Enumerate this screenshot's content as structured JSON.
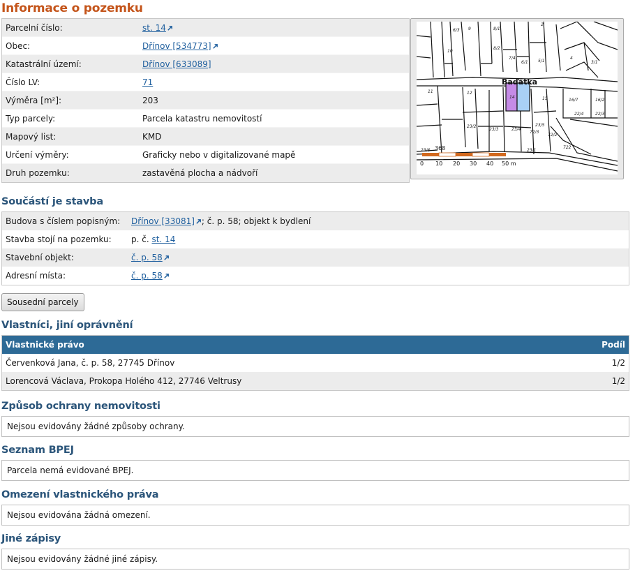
{
  "page_title": "Informace o pozemku",
  "parcel": {
    "rows": [
      {
        "label": "Parcelní číslo:",
        "value": "st. 14",
        "link": true,
        "ext": true
      },
      {
        "label": "Obec:",
        "value": "Dřínov [534773]",
        "link": true,
        "ext": true
      },
      {
        "label": "Katastrální území:",
        "value": "Dřínov [633089]",
        "link": true,
        "ext": false
      },
      {
        "label": "Číslo LV:",
        "value": "71",
        "link": true,
        "ext": false
      },
      {
        "label": "Výměra [m²]:",
        "value": "203",
        "link": false,
        "ext": false
      },
      {
        "label": "Typ parcely:",
        "value": "Parcela katastru nemovitostí",
        "link": false,
        "ext": false
      },
      {
        "label": "Mapový list:",
        "value": "KMD",
        "link": false,
        "ext": false
      },
      {
        "label": "Určení výměry:",
        "value": "Graficky nebo v digitalizované mapě",
        "link": false,
        "ext": false
      },
      {
        "label": "Druh pozemku:",
        "value": "zastavěná plocha a nádvoří",
        "link": false,
        "ext": false
      }
    ]
  },
  "map": {
    "street_label": "Baďátka",
    "scale_labels": [
      "0",
      "10",
      "20",
      "30",
      "40",
      "50 m"
    ],
    "parcel_labels": [
      "14",
      "15",
      "12",
      "11",
      "16/7",
      "23/2",
      "23/3",
      "23/4",
      "23/5",
      "23/1",
      "72/3",
      "72/2",
      "368",
      "23/6",
      "22/4",
      "22/3",
      "16/2",
      "3/1",
      "4",
      "7/4",
      "6/1",
      "5/1",
      "8/2",
      "8/1",
      "9",
      "10",
      "6/3",
      "722",
      "2"
    ],
    "colors": {
      "highlight_purple": "#c58be6",
      "highlight_blue": "#a9d0f5",
      "scale_orange": "#d2691e"
    }
  },
  "building": {
    "title": "Součástí je stavba",
    "rows": [
      {
        "label": "Budova s číslem popisným:",
        "link_text": "Dřínov [33081]",
        "ext": true,
        "suffix": "; č. p. 58; objekt k bydlení"
      },
      {
        "label": "Stavba stojí na pozemku:",
        "prefix": "p. č. ",
        "link_text": "st. 14",
        "ext": false,
        "suffix": ""
      },
      {
        "label": "Stavební objekt:",
        "link_text": "č. p. 58",
        "ext": true,
        "suffix": ""
      },
      {
        "label": "Adresní místa:",
        "link_text": "č. p. 58",
        "ext": true,
        "suffix": ""
      }
    ]
  },
  "neighbors_button": "Sousední parcely",
  "owners": {
    "title": "Vlastníci, jiní oprávnění",
    "col_right": "Vlastnické právo",
    "col_share": "Podíl",
    "rows": [
      {
        "name": "Červenková Jana, č. p. 58, 27745 Dřínov",
        "share": "1/2"
      },
      {
        "name": "Lorencová Václava, Prokopa Holého 412, 27746 Veltrusy",
        "share": "1/2"
      }
    ]
  },
  "protection": {
    "title": "Způsob ochrany nemovitosti",
    "text": "Nejsou evidovány žádné způsoby ochrany."
  },
  "bpej": {
    "title": "Seznam BPEJ",
    "text": "Parcela nemá evidované BPEJ."
  },
  "restrictions": {
    "title": "Omezení vlastnického práva",
    "text": "Nejsou evidována žádná omezení."
  },
  "other": {
    "title": "Jiné zápisy",
    "text": "Nejsou evidovány žádné jiné zápisy."
  },
  "colors": {
    "title_orange": "#c4541a",
    "section_blue": "#2b557a",
    "header_blue": "#2d6a96",
    "link_blue": "#1f5f9e"
  }
}
